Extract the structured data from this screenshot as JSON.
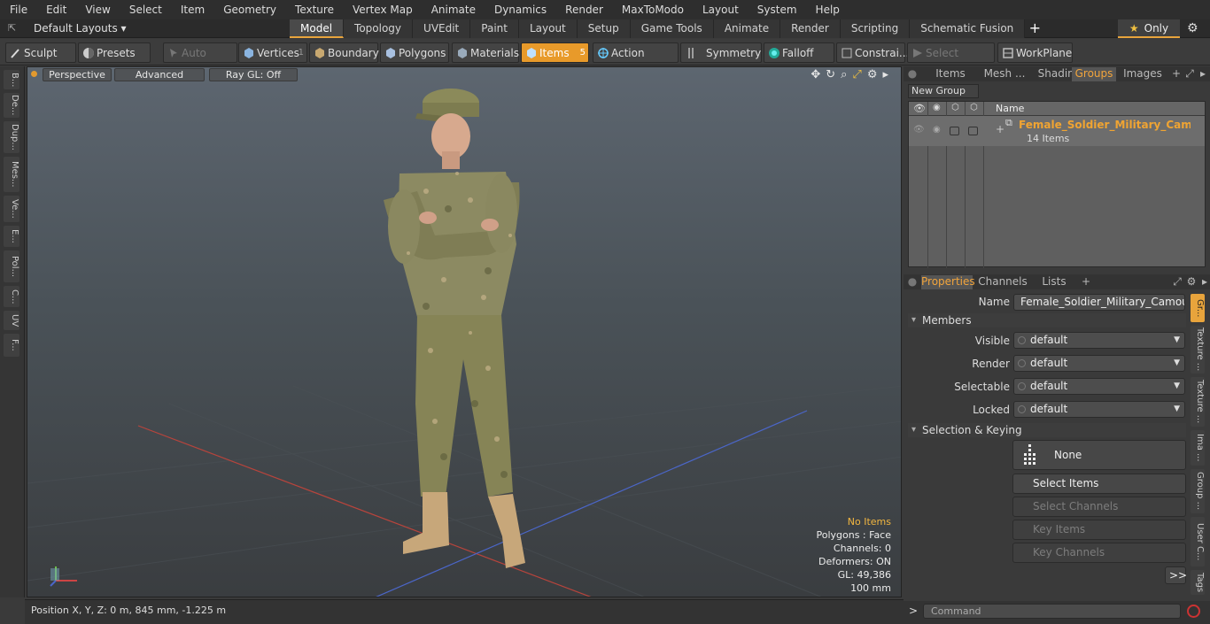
{
  "menu": [
    "File",
    "Edit",
    "View",
    "Select",
    "Item",
    "Geometry",
    "Texture",
    "Vertex Map",
    "Animate",
    "Dynamics",
    "Render",
    "MaxToModo",
    "Layout",
    "System",
    "Help"
  ],
  "layout_selector": "Default Layouts ▾",
  "mode_tabs": [
    "Model",
    "Topology",
    "UVEdit",
    "Paint",
    "Layout",
    "Setup",
    "Game Tools",
    "Animate",
    "Render",
    "Scripting",
    "Schematic Fusion"
  ],
  "active_mode_tab": "Model",
  "only_label": "Only",
  "toolbar": {
    "sculpt": "Sculpt",
    "presets": "Presets",
    "auto_select": "Auto Select",
    "vertices": "Vertices",
    "vertices_count": "1",
    "boundary": "Boundary",
    "polygons": "Polygons",
    "materials": "Materials",
    "items": "Items",
    "items_count": "5",
    "action_center": "Action Center",
    "symmetry": "Symmetry",
    "falloff": "Falloff",
    "constraints": "Constrai...",
    "select_through": "Select Through",
    "workplane": "WorkPlane"
  },
  "left_tabs": [
    "B...",
    "De...",
    "Dup...",
    "Mes...",
    "Ve...",
    "E...",
    "Pol...",
    "C...",
    "UV",
    "F..."
  ],
  "viewport": {
    "perspective": "Perspective",
    "advanced": "Advanced",
    "raygl": "Ray GL: Off",
    "info": {
      "items": "No Items",
      "polygons": "Polygons : Face",
      "channels": "Channels: 0",
      "deformers": "Deformers: ON",
      "gl": "GL: 49,386",
      "scale": "100 mm"
    }
  },
  "status": "Position X, Y, Z:   0 m, 845 mm, -1.225 m",
  "right_tabs": [
    "Items",
    "Mesh ...",
    "Shading",
    "Groups",
    "Images"
  ],
  "active_right_tab": "Groups",
  "new_group": "New Group",
  "group_table": {
    "header_name": "Name",
    "group_name": "Female_Soldier_Military_Camouflage_",
    "group_count": "14 Items"
  },
  "prop_tabs": [
    "Properties",
    "Channels",
    "Lists"
  ],
  "properties": {
    "name_label": "Name",
    "name_value": "Female_Soldier_Military_Camouflage_",
    "members_section": "Members",
    "visible_label": "Visible",
    "visible_value": "default",
    "render_label": "Render",
    "render_value": "default",
    "selectable_label": "Selectable",
    "selectable_value": "default",
    "locked_label": "Locked",
    "locked_value": "default",
    "sel_keying_section": "Selection & Keying",
    "none_btn": "None",
    "select_items": "Select Items",
    "select_channels": "Select Channels",
    "key_items": "Key Items",
    "key_channels": "Key Channels",
    "more": ">>"
  },
  "side_tabs": [
    "Gr...",
    "Texture ...",
    "Texture ...",
    "Ima ...",
    "Group ...",
    "User C...",
    "Tags"
  ],
  "command_placeholder": "Command"
}
